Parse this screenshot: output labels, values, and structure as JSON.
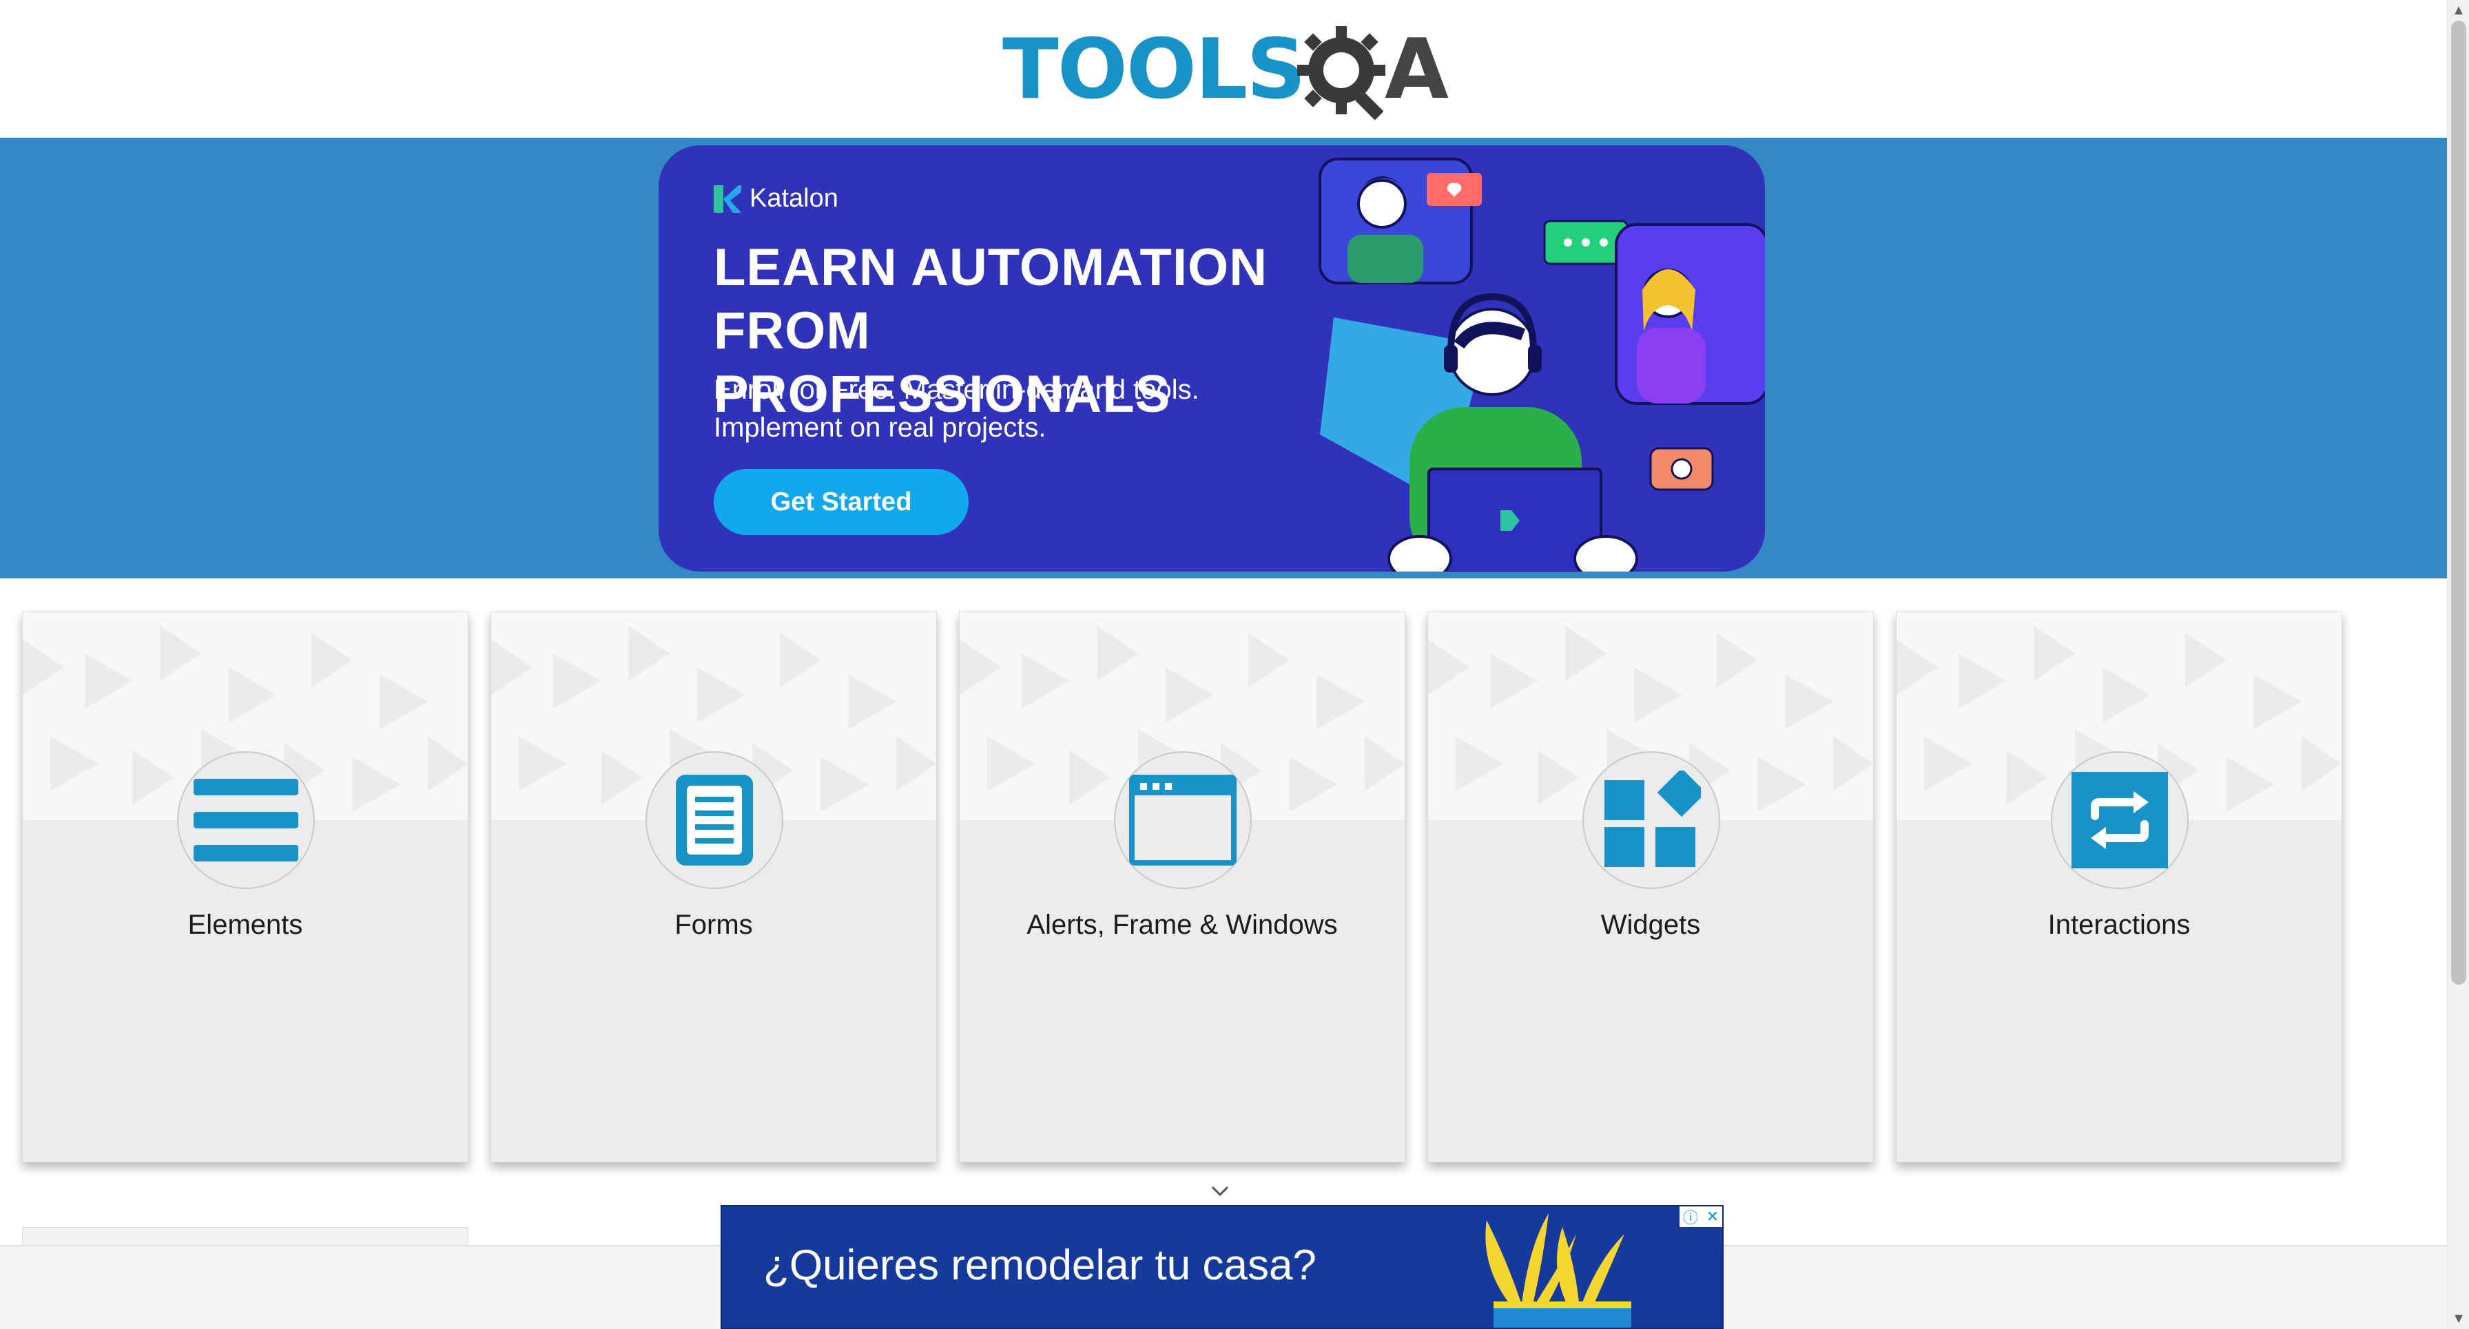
{
  "header": {
    "logo_text": "TOOLS",
    "logo_text_suffix": "A",
    "logo_icon": "gear-magnifier-icon"
  },
  "banner_ad": {
    "brand": "Katalon",
    "headline": "LEARN AUTOMATION FROM PROFESSIONALS",
    "subtext": "Enroll for Free. Master in-demand tools. Implement on real projects.",
    "cta_label": "Get Started"
  },
  "categories": [
    {
      "label": "Elements",
      "icon": "hamburger-icon"
    },
    {
      "label": "Forms",
      "icon": "document-icon"
    },
    {
      "label": "Alerts, Frame & Windows",
      "icon": "browser-window-icon"
    },
    {
      "label": "Widgets",
      "icon": "widgets-icon"
    },
    {
      "label": "Interactions",
      "icon": "swap-arrows-icon"
    }
  ],
  "bottom_ad": {
    "text": "¿Quieres remodelar tu casa?",
    "info_icon": "ⓘ",
    "close_icon": "✕"
  },
  "scrollbar": {
    "up": "▲",
    "down": "▼"
  },
  "colors": {
    "brand_blue": "#1892c9",
    "banner_strip": "#3389c6",
    "ad_bg": "#3033b9",
    "cta": "#12a8f0",
    "icon_blue": "#1892c9",
    "bottom_ad_bg": "#16399c"
  }
}
